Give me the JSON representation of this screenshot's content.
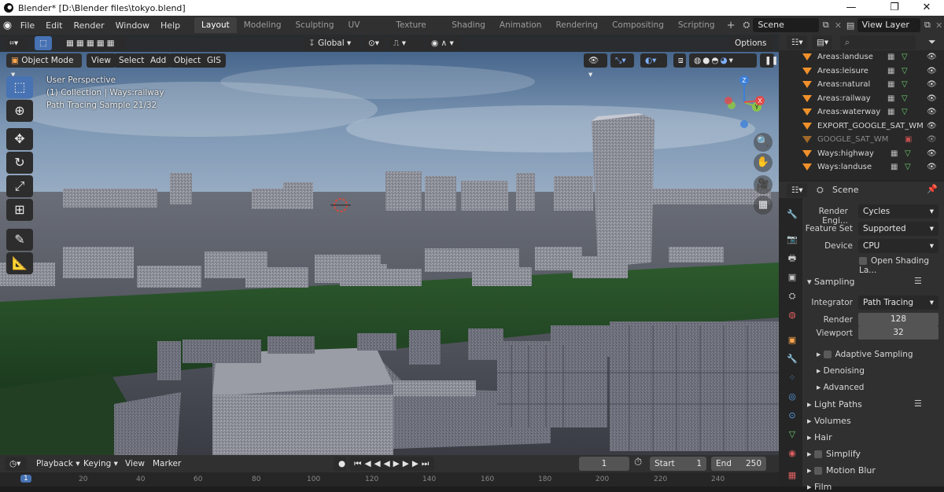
{
  "window": {
    "title": "Blender* [D:\\Blender files\\tokyo.blend]",
    "controls": [
      "—",
      "❐",
      "✕"
    ]
  },
  "menus": [
    "File",
    "Edit",
    "Render",
    "Window",
    "Help"
  ],
  "workspaces": [
    "Layout",
    "Modeling",
    "Sculpting",
    "UV Editing",
    "Texture Paint",
    "Shading",
    "Animation",
    "Rendering",
    "Compositing",
    "Scripting"
  ],
  "scene_name": "Scene",
  "view_layer": "View Layer",
  "viewport": {
    "transform_orientation": "Global",
    "options_label": "Options",
    "mode": "Object Mode",
    "header_menus": [
      "View",
      "Select",
      "Add",
      "Object",
      "GIS"
    ],
    "overlay_lines": [
      "User Perspective",
      "(1) Collection | Ways:railway",
      "Path Tracing Sample 21/32"
    ]
  },
  "gizmo": {
    "z": "Z",
    "y": "Y",
    "x": "X"
  },
  "timeline": {
    "menus": [
      "Playback",
      "Keying",
      "View",
      "Marker"
    ],
    "current_frame": "1",
    "start_label": "Start",
    "start": "1",
    "end_label": "End",
    "end": "250",
    "ruler": [
      "1",
      "20",
      "40",
      "60",
      "80",
      "100",
      "120",
      "140",
      "160",
      "180",
      "200",
      "220",
      "240"
    ]
  },
  "outliner": {
    "items": [
      {
        "name": "Areas:landuse",
        "dim": false
      },
      {
        "name": "Areas:leisure",
        "dim": false
      },
      {
        "name": "Areas:natural",
        "dim": false
      },
      {
        "name": "Areas:railway",
        "dim": false
      },
      {
        "name": "Areas:waterway",
        "dim": false
      },
      {
        "name": "EXPORT_GOOGLE_SAT_WM",
        "dim": false
      },
      {
        "name": "GOOGLE_SAT_WM",
        "dim": true
      },
      {
        "name": "Ways:highway",
        "dim": false
      },
      {
        "name": "Ways:landuse",
        "dim": false
      }
    ]
  },
  "properties": {
    "context": "Scene",
    "render_engine_label": "Render Engi...",
    "render_engine": "Cycles",
    "feature_set_label": "Feature Set",
    "feature_set": "Supported",
    "device_label": "Device",
    "device": "CPU",
    "open_shading": "Open Shading La...",
    "sampling_title": "Sampling",
    "integrator_label": "Integrator",
    "integrator": "Path Tracing",
    "render_label": "Render",
    "render_samples": "128",
    "viewport_label": "Viewport",
    "viewport_samples": "32",
    "adaptive": "Adaptive Sampling",
    "denoising": "Denoising",
    "advanced": "Advanced",
    "light_paths": "Light Paths",
    "volumes": "Volumes",
    "hair": "Hair",
    "simplify": "Simplify",
    "motion_blur": "Motion Blur",
    "film": "Film"
  }
}
